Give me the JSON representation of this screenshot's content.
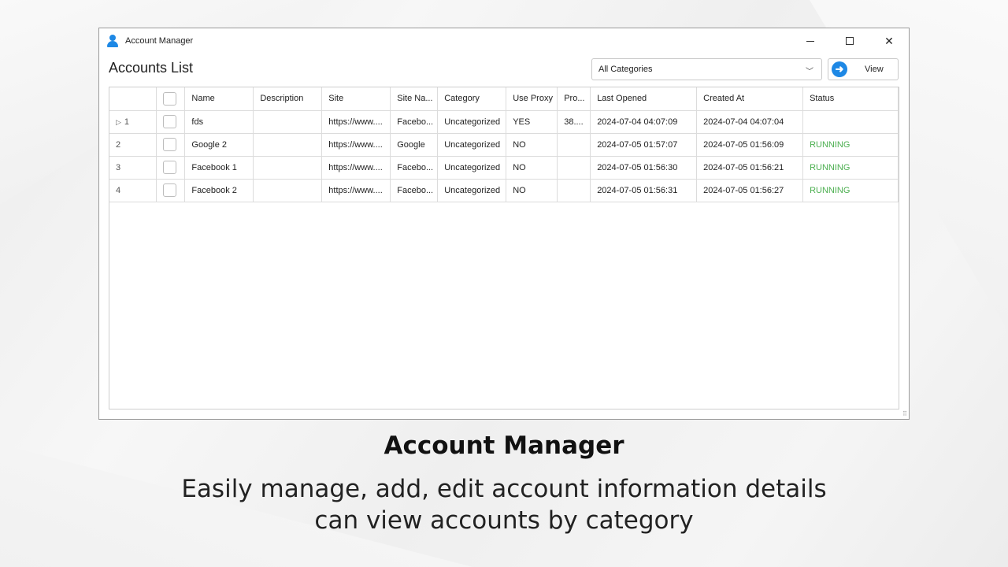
{
  "window": {
    "title": "Account Manager"
  },
  "header": {
    "list_title": "Accounts List",
    "category_selected": "All Categories",
    "view_label": "View"
  },
  "table": {
    "columns": [
      "Name",
      "Description",
      "Site",
      "Site Na...",
      "Category",
      "Use Proxy",
      "Pro...",
      "Last Opened",
      "Created At",
      "Status"
    ],
    "rows": [
      {
        "index": "1",
        "name": "fds",
        "description": "",
        "site": "https://www....",
        "site_name": "Facebo...",
        "category": "Uncategorized",
        "use_proxy": "YES",
        "proxy": "38....",
        "last_opened": "2024-07-04 04:07:09",
        "created_at": "2024-07-04 04:07:04",
        "status": ""
      },
      {
        "index": "2",
        "name": "Google 2",
        "description": "",
        "site": "https://www....",
        "site_name": "Google",
        "category": "Uncategorized",
        "use_proxy": "NO",
        "proxy": "",
        "last_opened": "2024-07-05 01:57:07",
        "created_at": "2024-07-05 01:56:09",
        "status": "RUNNING"
      },
      {
        "index": "3",
        "name": "Facebook 1",
        "description": "",
        "site": "https://www....",
        "site_name": "Facebo...",
        "category": "Uncategorized",
        "use_proxy": "NO",
        "proxy": "",
        "last_opened": "2024-07-05 01:56:30",
        "created_at": "2024-07-05 01:56:21",
        "status": "RUNNING"
      },
      {
        "index": "4",
        "name": "Facebook 2",
        "description": "",
        "site": "https://www....",
        "site_name": "Facebo...",
        "category": "Uncategorized",
        "use_proxy": "NO",
        "proxy": "",
        "last_opened": "2024-07-05 01:56:31",
        "created_at": "2024-07-05 01:56:27",
        "status": "RUNNING"
      }
    ]
  },
  "caption": {
    "title": "Account Manager",
    "line1": "Easily manage, add, edit account information details",
    "line2": "can view accounts by category"
  },
  "colors": {
    "accent": "#1e88e5",
    "running": "#4caf50"
  },
  "icons": {
    "app": "user-icon",
    "view": "arrow-right-circle-icon",
    "dropdown": "chevron-down-icon"
  }
}
